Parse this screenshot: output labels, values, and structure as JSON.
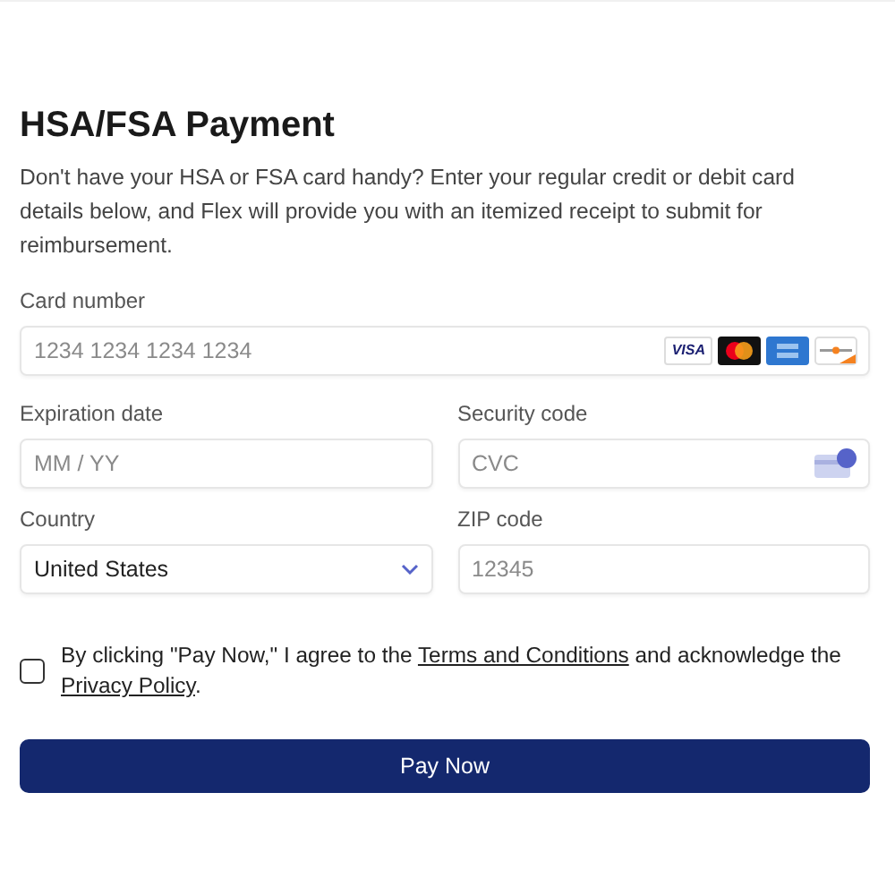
{
  "title": "HSA/FSA Payment",
  "description": "Don't have your HSA or FSA card handy? Enter your regular credit or debit card details below, and Flex will provide you with an itemized receipt to submit for reimbursement.",
  "card_number": {
    "label": "Card number",
    "placeholder": "1234 1234 1234 1234",
    "brand_text": "VISA"
  },
  "expiration": {
    "label": "Expiration date",
    "placeholder": "MM / YY"
  },
  "security": {
    "label": "Security code",
    "placeholder": "CVC"
  },
  "country": {
    "label": "Country",
    "value": "United States"
  },
  "zip": {
    "label": "ZIP code",
    "placeholder": "12345"
  },
  "consent": {
    "checked": false,
    "before": "By clicking \"Pay Now,\" I agree to the ",
    "terms_link": "Terms and Conditions",
    "middle": " and acknowledge the ",
    "privacy_link": "Privacy Policy",
    "after": "."
  },
  "submit": "Pay Now"
}
